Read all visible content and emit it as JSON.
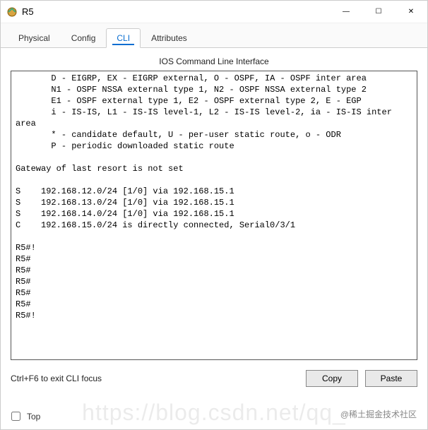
{
  "window": {
    "title": "R5",
    "minimize": "—",
    "maximize": "☐",
    "close": "✕"
  },
  "tabs": {
    "physical": "Physical",
    "config": "Config",
    "cli": "CLI",
    "attributes": "Attributes"
  },
  "subtitle": "IOS Command Line Interface",
  "terminal_text": "       D - EIGRP, EX - EIGRP external, O - OSPF, IA - OSPF inter area\n       N1 - OSPF NSSA external type 1, N2 - OSPF NSSA external type 2\n       E1 - OSPF external type 1, E2 - OSPF external type 2, E - EGP\n       i - IS-IS, L1 - IS-IS level-1, L2 - IS-IS level-2, ia - IS-IS inter area\n       * - candidate default, U - per-user static route, o - ODR\n       P - periodic downloaded static route\n\nGateway of last resort is not set\n\nS    192.168.12.0/24 [1/0] via 192.168.15.1\nS    192.168.13.0/24 [1/0] via 192.168.15.1\nS    192.168.14.0/24 [1/0] via 192.168.15.1\nC    192.168.15.0/24 is directly connected, Serial0/3/1\n\nR5#!\nR5#\nR5#\nR5#\nR5#\nR5#\nR5#!",
  "footer": {
    "hint": "Ctrl+F6 to exit CLI focus",
    "copy": "Copy",
    "paste": "Paste"
  },
  "bottom": {
    "checkbox_label": "Top"
  },
  "watermark_bg": "https://blog.csdn.net/qq_",
  "credit": "@稀土掘金技术社区"
}
